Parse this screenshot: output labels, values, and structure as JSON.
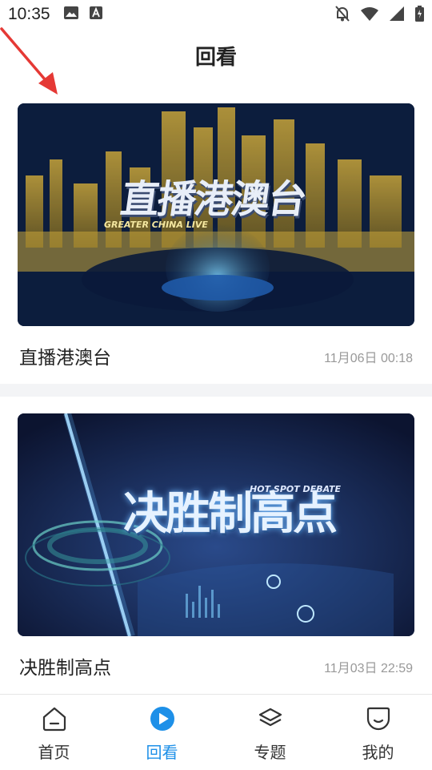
{
  "status_bar": {
    "time": "10:35",
    "left_icons": [
      "image-icon",
      "a-icon"
    ],
    "right_icons": [
      "bell-off-icon",
      "wifi-icon",
      "signal-icon",
      "battery-icon"
    ]
  },
  "header": {
    "title": "回看"
  },
  "annotation": {
    "arrow_color": "#e53935"
  },
  "cards": [
    {
      "title": "直播港澳台",
      "time": "11月06日 00:18",
      "thumbnail": {
        "headline": "直播港澳台",
        "subline": "GREATER CHINA LIVE"
      }
    },
    {
      "title": "决胜制高点",
      "time": "11月03日 22:59",
      "thumbnail": {
        "headline": "决胜制高点",
        "subline": "HOT SPOT DEBATE"
      }
    }
  ],
  "bottom_nav": {
    "items": [
      {
        "label": "首页",
        "icon": "home-icon",
        "active": false
      },
      {
        "label": "回看",
        "icon": "play-circle-icon",
        "active": true
      },
      {
        "label": "专题",
        "icon": "layers-icon",
        "active": false
      },
      {
        "label": "我的",
        "icon": "profile-icon",
        "active": false
      }
    ],
    "active_color": "#1e90e8"
  }
}
